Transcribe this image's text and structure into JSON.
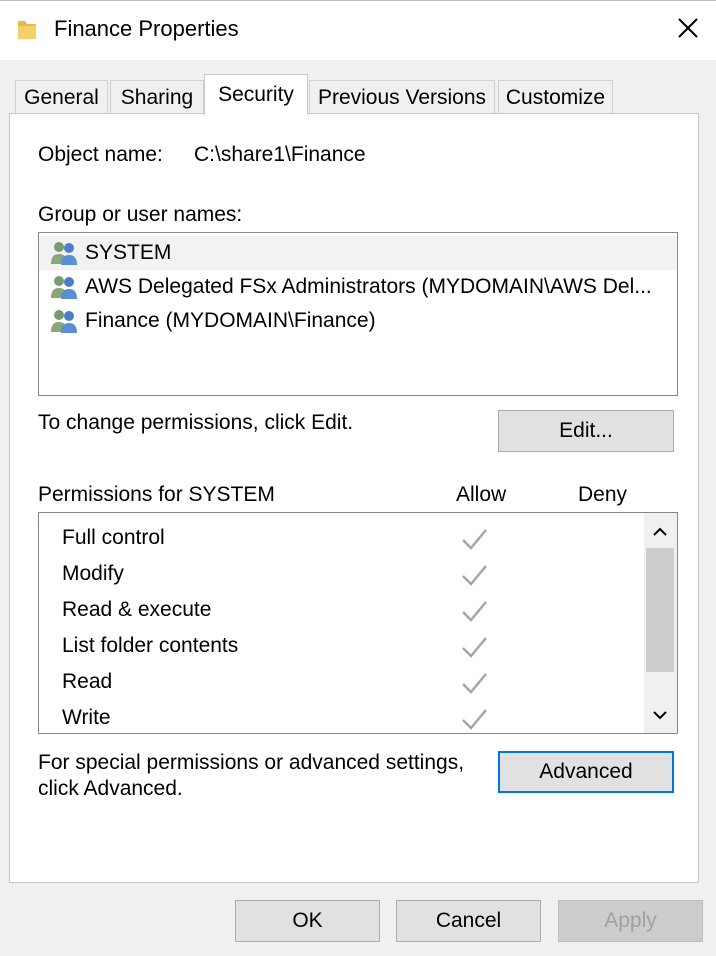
{
  "window": {
    "title": "Finance Properties",
    "icon": "folder-icon",
    "close_icon": "close-icon"
  },
  "tabs": [
    {
      "label": "General",
      "active": false
    },
    {
      "label": "Sharing",
      "active": false
    },
    {
      "label": "Security",
      "active": true
    },
    {
      "label": "Previous Versions",
      "active": false
    },
    {
      "label": "Customize",
      "active": false
    }
  ],
  "security": {
    "object_name_label": "Object name:",
    "object_name_value": "C:\\share1\\Finance",
    "group_label": "Group or user names:",
    "groups": [
      {
        "name": "SYSTEM",
        "icon": "user-group-icon",
        "selected": true
      },
      {
        "name": "AWS Delegated FSx Administrators (MYDOMAIN\\AWS Del...",
        "icon": "user-group-icon",
        "selected": false
      },
      {
        "name": "Finance (MYDOMAIN\\Finance)",
        "icon": "user-group-icon",
        "selected": false
      }
    ],
    "change_hint": "To change permissions, click Edit.",
    "edit_button": "Edit...",
    "permissions_label": "Permissions for SYSTEM",
    "allow_header": "Allow",
    "deny_header": "Deny",
    "permissions": [
      {
        "name": "Full control",
        "allow": true,
        "deny": false
      },
      {
        "name": "Modify",
        "allow": true,
        "deny": false
      },
      {
        "name": "Read & execute",
        "allow": true,
        "deny": false
      },
      {
        "name": "List folder contents",
        "allow": true,
        "deny": false
      },
      {
        "name": "Read",
        "allow": true,
        "deny": false
      },
      {
        "name": "Write",
        "allow": true,
        "deny": false
      }
    ],
    "advanced_hint_line1": "For special permissions or advanced settings,",
    "advanced_hint_line2": "click Advanced.",
    "advanced_button": "Advanced"
  },
  "footer": {
    "ok": "OK",
    "cancel": "Cancel",
    "apply": "Apply"
  },
  "colors": {
    "accent": "#0078d7",
    "check": "#a6a6a6",
    "folder": "#e8b94a"
  }
}
